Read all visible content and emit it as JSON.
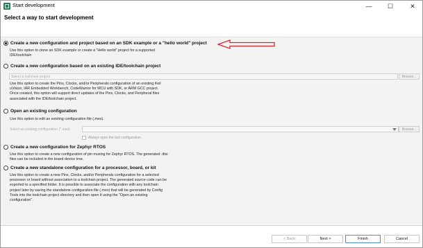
{
  "window": {
    "title": "Start development",
    "controls": {
      "minimize": "—",
      "maximize": "☐",
      "close": "✕"
    }
  },
  "header": {
    "title": "Select a way to start development"
  },
  "options": [
    {
      "label": "Create a new configuration and project based on an SDK example or a \"hello world\" project",
      "desc_lines": [
        "Use this option to clone an SDK example or create a \"Hello world\" project for a supported",
        "IDE/toolchain"
      ],
      "checked": true
    },
    {
      "label": "Create a new configuration based on an existing IDE/toolchain project",
      "field_placeholder": "Select a toolchain project",
      "browse": "Browse...",
      "desc_lines": [
        "Use this option to create the Pins, Clocks, and/or Peripherals configuration of an existing Keil",
        "uVision, IAR Embedded Workbench, CodeWarrior for MCU with SDK, or ARM GCC project.",
        "Once created, this option will support direct updates of the Pins, Clocks, and Peripheral files",
        "associated with the IDE/toolchain project."
      ],
      "checked": false
    },
    {
      "label": "Open an existing configuration",
      "desc_lines": [
        "Use this option to edit an existing configuration file (.mex)."
      ],
      "field_label": "Select an existing configuration (*.mex)",
      "browse": "Browse...",
      "checkbox_label": "Always open the last configuration.",
      "checked": false
    },
    {
      "label": "Create a new configuration for Zephyr RTOS",
      "desc_lines": [
        "Use this option to create a new configuration of pin muxing for Zephyr RTOS. The generated .dtsi",
        "files can be included in the board device tree."
      ],
      "checked": false
    },
    {
      "label": "Create a new standalone configuration for a processor, board, or kit",
      "desc_lines": [
        "Use this option to create a new Pins, Clocks, and/or Peripherals configuration for a selected",
        "processor or board without association to a toolchain project. The generated source code can be",
        "exported to a specified folder. It is possible to associate the configuration with any toolchain",
        "project later by saving the standalone configuration file (.mex) that will be generated by Config",
        "Tools into the toolchain project directory and then open it using the \"Open an existing",
        "configuration\"."
      ],
      "checked": false
    }
  ],
  "footer": {
    "back": "< Back",
    "next": "Next >",
    "finish": "Finish",
    "cancel": "Cancel"
  },
  "colors": {
    "accent_arrow": "#d9262c",
    "primary_border": "#4a8de0"
  }
}
